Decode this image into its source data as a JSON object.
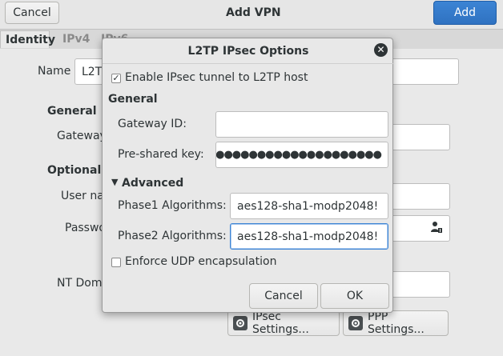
{
  "window": {
    "title": "Add VPN",
    "cancel_label": "Cancel",
    "add_label": "Add",
    "tabs": [
      {
        "label": "Identity"
      },
      {
        "label": "IPv4"
      },
      {
        "label": "IPv6"
      }
    ],
    "name_label": "Name",
    "name_value": "L2TP",
    "general_heading": "General",
    "gateway_label": "Gateway",
    "optional_heading": "Optional",
    "user_name_label": "User name",
    "password_label": "Password",
    "nt_domain_label": "NT Domain",
    "ipsec_settings_label": "IPsec Settings...",
    "ppp_settings_label": "PPP Settings..."
  },
  "dialog": {
    "title": "L2TP IPsec Options",
    "enable_ipsec_label": "Enable IPsec tunnel to L2TP host",
    "enable_ipsec_checked": true,
    "general_heading": "General",
    "gateway_id_label": "Gateway ID:",
    "gateway_id_value": "",
    "psk_label": "Pre-shared key:",
    "psk_value": "●●●●●●●●●●●●●●●●●●●●●",
    "advanced_heading": "Advanced",
    "phase1_label": "Phase1 Algorithms:",
    "phase1_value": "aes128-sha1-modp2048!",
    "phase2_label": "Phase2 Algorithms:",
    "phase2_value": "aes128-sha1-modp2048!",
    "enforce_udp_label": "Enforce UDP encapsulation",
    "enforce_udp_checked": false,
    "cancel_label": "Cancel",
    "ok_label": "OK"
  },
  "icons": {
    "close": "close-icon",
    "expander": "triangle-down-icon",
    "settings": "settings-icon",
    "user": "user-lock-icon"
  },
  "colors": {
    "accent": "#3c84d4",
    "background": "#e8e8e8"
  }
}
